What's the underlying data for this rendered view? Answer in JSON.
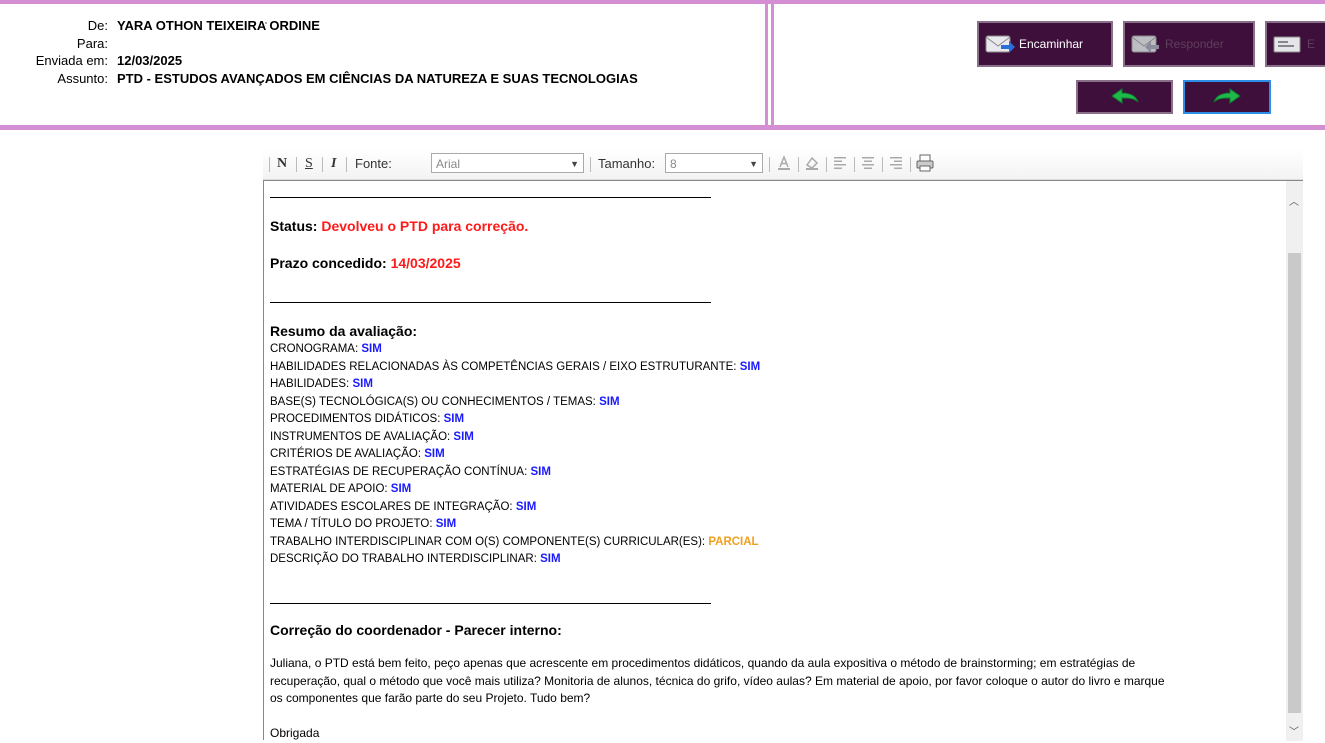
{
  "header": {
    "from_label": "De:",
    "from_value": "YARA OTHON TEIXEIRA ORDINE",
    "to_label": "Para:",
    "to_value": "",
    "sent_label": "Enviada em:",
    "sent_value": "12/03/2025",
    "subject_label": "Assunto:",
    "subject_value": "PTD - ESTUDOS AVANÇADOS EM CIÊNCIAS DA NATUREZA E SUAS TECNOLOGIAS",
    "forward_label": "Encaminhar",
    "reply_label": "Responder",
    "delete_label": "E"
  },
  "toolbar": {
    "bold": "N",
    "underline": "S",
    "italic": "I",
    "font_label": "Fonte:",
    "font_value": "Arial",
    "size_label": "Tamanho:",
    "size_value": "8"
  },
  "message": {
    "status_label": "Status:",
    "status_value": "Devolveu o PTD para correção.",
    "deadline_label": "Prazo concedido:",
    "deadline_value": "14/03/2025",
    "summary_title": "Resumo da avaliação:",
    "items": [
      {
        "label": "CRONOGRAMA:",
        "value": "SIM"
      },
      {
        "label": "HABILIDADES RELACIONADAS ÀS COMPETÊNCIAS GERAIS / EIXO ESTRUTURANTE:",
        "value": "SIM"
      },
      {
        "label": "HABILIDADES:",
        "value": "SIM"
      },
      {
        "label": "BASE(S) TECNOLÓGICA(S) OU CONHECIMENTOS / TEMAS:",
        "value": "SIM"
      },
      {
        "label": "PROCEDIMENTOS DIDÁTICOS:",
        "value": "SIM"
      },
      {
        "label": "INSTRUMENTOS DE AVALIAÇÃO:",
        "value": "SIM"
      },
      {
        "label": "CRITÉRIOS DE AVALIAÇÃO:",
        "value": "SIM"
      },
      {
        "label": "ESTRATÉGIAS DE RECUPERAÇÃO CONTÍNUA:",
        "value": "SIM"
      },
      {
        "label": "MATERIAL DE APOIO:",
        "value": "SIM"
      },
      {
        "label": "ATIVIDADES ESCOLARES DE INTEGRAÇÃO:",
        "value": "SIM"
      },
      {
        "label": "TEMA / TÍTULO DO PROJETO:",
        "value": "SIM"
      },
      {
        "label": "TRABALHO INTERDISCIPLINAR COM O(S) COMPONENTE(S) CURRICULAR(ES):",
        "value": "PARCIAL"
      },
      {
        "label": "DESCRIÇÃO DO TRABALHO INTERDISCIPLINAR:",
        "value": "SIM"
      }
    ],
    "correction_title": "Correção do coordenador - Parecer interno:",
    "correction_text_1": "Juliana, o PTD está bem feito, peço apenas que acrescente em procedimentos didáticos, quando da aula expositiva o método de brainstorming; em estratégias de",
    "correction_text_2": "recuperação, qual o método que você mais utiliza? Monitoria de alunos, técnica do grifo, vídeo aulas? Em material de apoio, por favor coloque o autor do livro e marque",
    "correction_text_3": "os componentes que farão parte do seu Projeto. Tudo bem?",
    "closing": "Obrigada"
  }
}
